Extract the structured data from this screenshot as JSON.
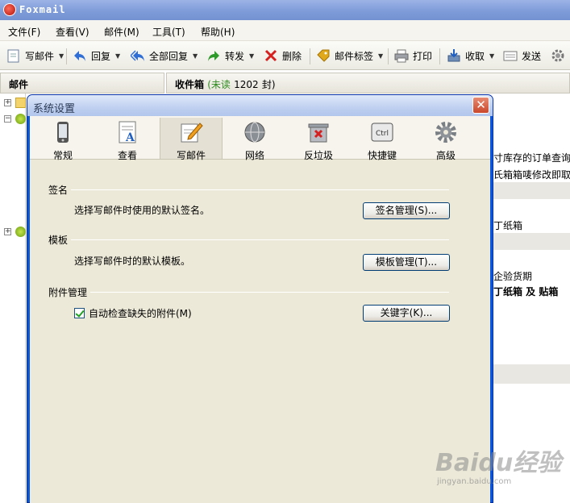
{
  "app": {
    "title": "Foxmail",
    "menu": [
      "文件(F)",
      "查看(V)",
      "邮件(M)",
      "工具(T)",
      "帮助(H)"
    ],
    "toolbar": {
      "compose": "写邮件",
      "reply": "回复",
      "reply_all": "全部回复",
      "forward": "转发",
      "delete": "删除",
      "tags": "邮件标签",
      "print": "打印",
      "receive": "收取",
      "send": "发送"
    },
    "left_header": "邮件",
    "right_header": {
      "folder": "收件箱",
      "unread_prefix": "(未读",
      "unread_count": "1202",
      "unread_suffix": "封)"
    },
    "list_fragments": [
      "寸库存的订单查询",
      "氏箱箱唛修改即取",
      "丁纸箱",
      "企验货期",
      "丁纸箱 及 贴箱"
    ]
  },
  "dialog": {
    "title": "系统设置",
    "close_glyph": "✕",
    "tabs": [
      "常规",
      "查看",
      "写邮件",
      "网络",
      "反垃圾",
      "快捷键",
      "高级"
    ],
    "active_tab": "写邮件",
    "shortcut_icon_text": "Ctrl",
    "signature": {
      "title": "签名",
      "description": "选择写邮件时使用的默认签名。",
      "button": "签名管理(S)..."
    },
    "template": {
      "title": "模板",
      "description": "选择写邮件时的默认模板。",
      "button": "模板管理(T)..."
    },
    "attachment": {
      "title": "附件管理",
      "checkbox_label": "自动检查缺失的附件(M)",
      "checked": true,
      "button": "关键字(K)..."
    }
  },
  "watermark": {
    "main": "Baidu经验",
    "sub": "jingyan.baidu.com"
  },
  "colors": {
    "dialog_frame": "#0a57d8",
    "dialog_body": "#ece9d8",
    "unread_green": "#2e8b1e"
  }
}
